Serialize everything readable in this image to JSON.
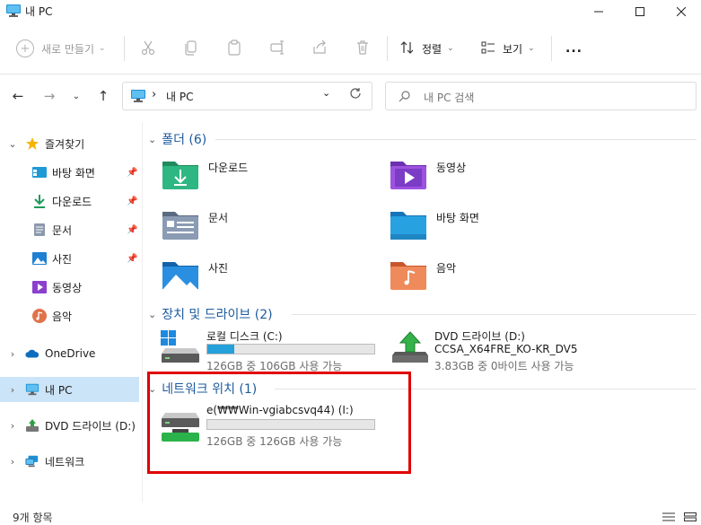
{
  "window": {
    "title": "내 PC",
    "controls": [
      "minimize",
      "maximize",
      "close"
    ]
  },
  "toolbar": {
    "new_label": "새로 만들기",
    "sort_label": "정렬",
    "view_label": "보기",
    "more_label": "..."
  },
  "address": {
    "separator": "›",
    "path": "내 PC"
  },
  "search": {
    "placeholder": "내 PC 검색"
  },
  "nav": {
    "quick_access": "즐겨찾기",
    "pinned": [
      {
        "label": "바탕 화면",
        "icon": "desktop-icon"
      },
      {
        "label": "다운로드",
        "icon": "download-icon"
      },
      {
        "label": "문서",
        "icon": "document-icon"
      },
      {
        "label": "사진",
        "icon": "picture-icon"
      },
      {
        "label": "동영상",
        "icon": "video-icon"
      },
      {
        "label": "음악",
        "icon": "music-icon"
      }
    ],
    "onedrive": "OneDrive",
    "this_pc": "내 PC",
    "dvd": "DVD 드라이브 (D:)",
    "network": "네트워크"
  },
  "main": {
    "folders_header": "폴더 (6)",
    "folders": [
      {
        "label": "다운로드",
        "icon": "download-folder-icon"
      },
      {
        "label": "동영상",
        "icon": "video-folder-icon"
      },
      {
        "label": "문서",
        "icon": "document-folder-icon"
      },
      {
        "label": "바탕 화면",
        "icon": "desktop-folder-icon"
      },
      {
        "label": "사진",
        "icon": "picture-folder-icon"
      },
      {
        "label": "음악",
        "icon": "music-folder-icon"
      }
    ],
    "devices_header": "장치 및 드라이브 (2)",
    "local_disk": {
      "name": "로컬 디스크 (C:)",
      "space": "126GB 중 106GB 사용 가능",
      "used_fraction": 0.16
    },
    "dvd": {
      "name": "DVD 드라이브 (D:)",
      "volume": "CCSA_X64FRE_KO-KR_DV5",
      "space": "3.83GB 중 0바이트 사용 가능"
    },
    "network_header": "네트워크 위치 (1)",
    "network_drive": {
      "name": "e(₩₩Win-vgiabcsvq44) (I:)",
      "space": "126GB 중 126GB 사용 가능",
      "used_fraction": 0.0
    }
  },
  "status": {
    "item_count": "9개 항목"
  },
  "colors": {
    "accent": "#26a0da",
    "selection": "#cce4f7",
    "header_text": "#1d5a9e",
    "highlight_box": "#e00000"
  }
}
